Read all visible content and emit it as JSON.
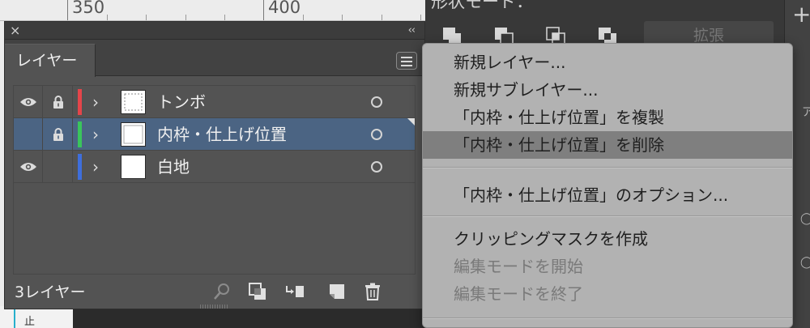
{
  "ruler": {
    "label_left": "350",
    "label_right": "400"
  },
  "document": {
    "visible_char": "止"
  },
  "layers_panel": {
    "close_glyph": "×",
    "collapse_glyph": "‹‹",
    "tab_label": "レイヤー",
    "layers": [
      {
        "name": "トンボ",
        "visible": true,
        "locked": true,
        "color": "#e5454a",
        "selected": false
      },
      {
        "name": "内枠・仕上げ位置",
        "visible": false,
        "locked": true,
        "color": "#3ac55c",
        "selected": true
      },
      {
        "name": "白地",
        "visible": true,
        "locked": false,
        "color": "#3e6edc",
        "selected": false
      }
    ],
    "footer": {
      "layer_count": "3レイヤー"
    }
  },
  "pathfinder": {
    "shape_mode_label": "形状モード：",
    "expand_label": "拡張"
  },
  "context_menu": {
    "items": [
      {
        "label": "新規レイヤー...",
        "state": "normal"
      },
      {
        "label": "新規サブレイヤー...",
        "state": "normal"
      },
      {
        "label": "「内枠・仕上げ位置」を複製",
        "state": "normal"
      },
      {
        "label": "「内枠・仕上げ位置」を削除",
        "state": "highlighted"
      },
      {
        "label": "「内枠・仕上げ位置」のオプション...",
        "state": "normal"
      },
      {
        "label": "クリッピングマスクを作成",
        "state": "normal"
      },
      {
        "label": "編集モードを開始",
        "state": "disabled"
      },
      {
        "label": "編集モードを終了",
        "state": "disabled"
      }
    ]
  },
  "colors": {
    "panel_bg": "#535353",
    "selected_row": "#4b6483",
    "menu_bg": "#b2b2b2",
    "menu_highlight": "#7f7f7f"
  }
}
